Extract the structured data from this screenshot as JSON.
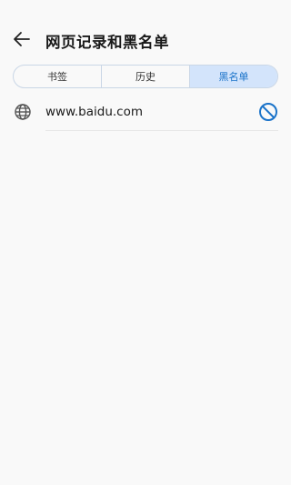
{
  "header": {
    "title": "网页记录和黑名单",
    "back_icon": "arrow-left-icon"
  },
  "tabs": [
    {
      "label": "书签",
      "active": false
    },
    {
      "label": "历史",
      "active": false
    },
    {
      "label": "黑名单",
      "active": true
    }
  ],
  "blacklist": {
    "items": [
      {
        "url": "www.baidu.com",
        "icon": "globe-icon",
        "action_icon": "block-icon"
      }
    ]
  },
  "colors": {
    "accent": "#1a73c9",
    "active_tab_bg": "#d3e4fb",
    "background": "#f9f9f9"
  }
}
